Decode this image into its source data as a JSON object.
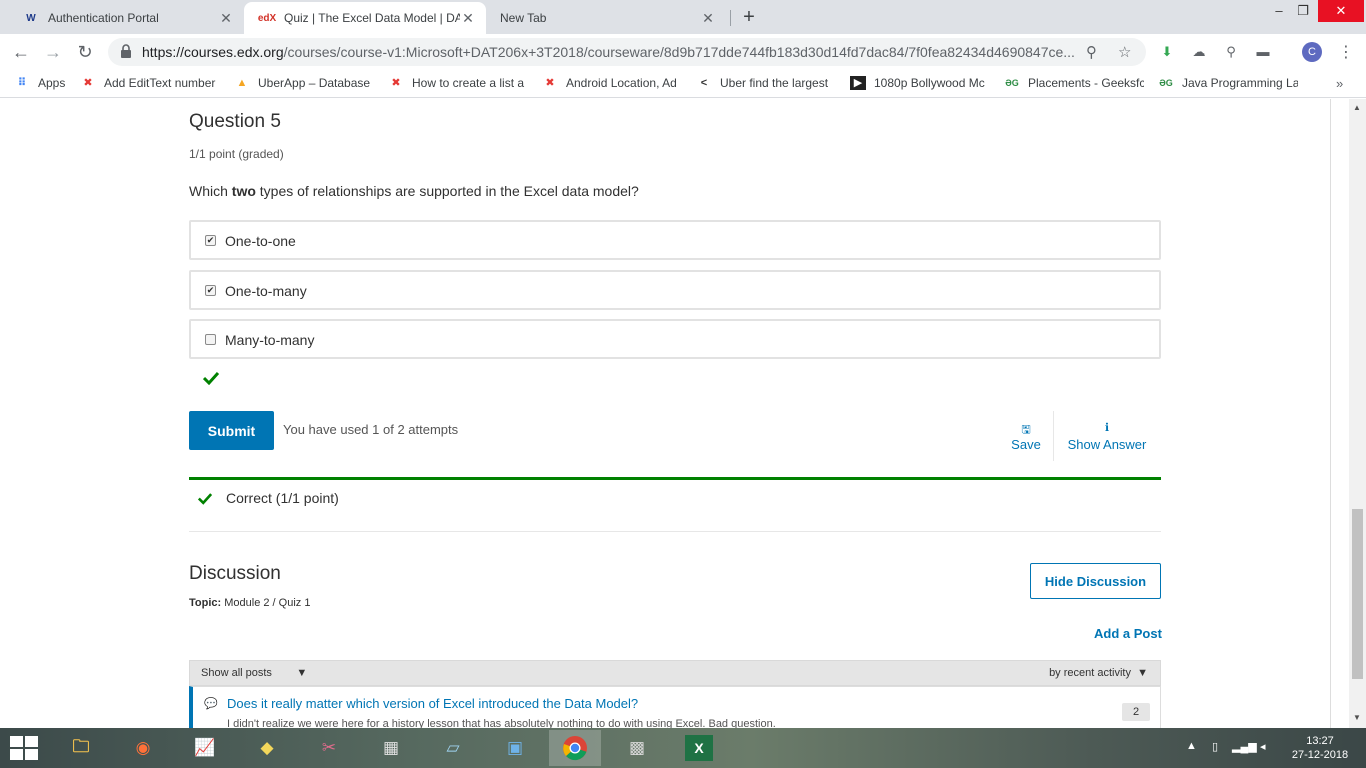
{
  "browser": {
    "tabs": [
      {
        "title": "Authentication Portal",
        "favicon": "W",
        "active": false
      },
      {
        "title": "Quiz | The Excel Data Model | DA",
        "favicon": "edX",
        "active": true
      },
      {
        "title": "New Tab",
        "favicon": "",
        "active": false
      }
    ],
    "url_host": "https://courses.edx.org",
    "url_path": "/courses/course-v1:Microsoft+DAT206x+3T2018/courseware/8d9b717dde744fb183d30d14fd7dac84/7f0fea82434d4690847ce...",
    "profile_initial": "C",
    "bookmarks": [
      "Apps",
      "Add EditText number",
      "UberApp – Database",
      "How to create a list a",
      "Android Location, Ad",
      "Uber find the largest",
      "1080p Bollywood Mc",
      "Placements - Geeksfc",
      "Java Programming La"
    ]
  },
  "question": {
    "title": "Question 5",
    "points": "1/1 point (graded)",
    "text_before": "Which ",
    "text_bold": "two",
    "text_after": " types of relationships are supported in the Excel data model?",
    "choices": [
      {
        "label": "One-to-one",
        "checked": true
      },
      {
        "label": "One-to-many",
        "checked": true
      },
      {
        "label": "Many-to-many",
        "checked": false
      }
    ],
    "submit_label": "Submit",
    "attempts": "You have used 1 of 2 attempts",
    "save_label": "Save",
    "show_answer_label": "Show Answer",
    "result": "Correct (1/1 point)"
  },
  "discussion": {
    "title": "Discussion",
    "topic_label": "Topic:",
    "topic_value": " Module 2 / Quiz 1",
    "hide_label": "Hide Discussion",
    "add_post_label": "Add a Post",
    "filter_left": "Show all posts",
    "filter_right": "by recent activity",
    "post": {
      "title": "Does it really matter which version of Excel introduced the Data Model?",
      "preview": "I didn't realize we were here for a history lesson that has absolutely nothing to do with using Excel. Bad question.",
      "count": "2"
    }
  },
  "taskbar": {
    "time": "13:27",
    "date": "27-12-2018"
  },
  "colors": {
    "accent": "#0075b4",
    "success": "#008100"
  }
}
